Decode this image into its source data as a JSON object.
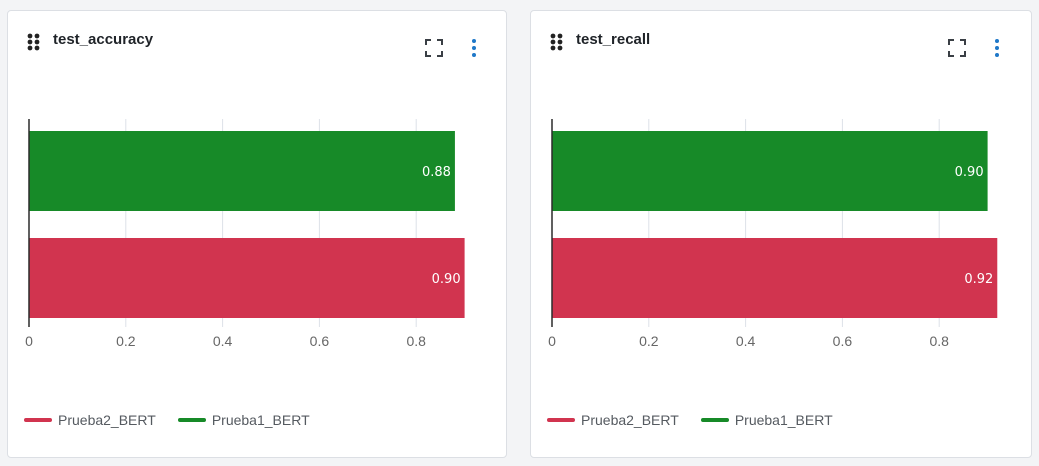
{
  "colors": {
    "prueba2": "#d1344f",
    "prueba1": "#178a28",
    "grid": "#dde1e8",
    "axis": "#2b2b2b",
    "icon_accent": "#1f78c8",
    "icon_dark": "#3a3f45"
  },
  "icons": {
    "drag": "drag-handle-icon",
    "expand": "expand-icon",
    "more": "more-vertical-icon"
  },
  "chart_data": [
    {
      "type": "bar",
      "orientation": "horizontal",
      "title": "test_accuracy",
      "xlim": [
        0,
        0.93
      ],
      "x_ticks": [
        "0",
        "0.2",
        "0.4",
        "0.6",
        "0.8"
      ],
      "x_tick_values": [
        0,
        0.2,
        0.4,
        0.6,
        0.8
      ],
      "grid": true,
      "legend_position": "bottom-left",
      "legend_order": [
        "Prueba2_BERT",
        "Prueba1_BERT"
      ],
      "series": [
        {
          "name": "Prueba1_BERT",
          "value": 0.88,
          "label": "0.88",
          "color_key": "prueba1"
        },
        {
          "name": "Prueba2_BERT",
          "value": 0.9,
          "label": "0.90",
          "color_key": "prueba2"
        }
      ]
    },
    {
      "type": "bar",
      "orientation": "horizontal",
      "title": "test_recall",
      "xlim": [
        0,
        0.93
      ],
      "x_ticks": [
        "0",
        "0.2",
        "0.4",
        "0.6",
        "0.8"
      ],
      "x_tick_values": [
        0,
        0.2,
        0.4,
        0.6,
        0.8
      ],
      "grid": true,
      "legend_position": "bottom-left",
      "legend_order": [
        "Prueba2_BERT",
        "Prueba1_BERT"
      ],
      "series": [
        {
          "name": "Prueba1_BERT",
          "value": 0.9,
          "label": "0.90",
          "color_key": "prueba1"
        },
        {
          "name": "Prueba2_BERT",
          "value": 0.92,
          "label": "0.92",
          "color_key": "prueba2"
        }
      ]
    }
  ]
}
